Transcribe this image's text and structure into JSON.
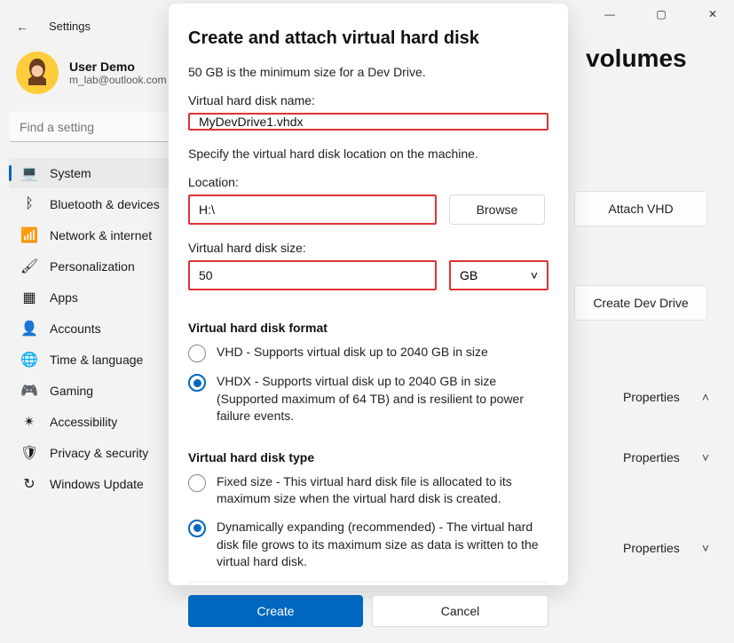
{
  "titlebar": {
    "back": "←",
    "title": "Settings",
    "min": "—",
    "max": "▢",
    "close": "✕"
  },
  "user": {
    "name": "User Demo",
    "email": "m_lab@outlook.com"
  },
  "search": {
    "placeholder": "Find a setting"
  },
  "nav": [
    {
      "icon": "💻",
      "label": "System",
      "active": true
    },
    {
      "icon": "ᛒ",
      "label": "Bluetooth & devices"
    },
    {
      "icon": "📶",
      "label": "Network & internet"
    },
    {
      "icon": "🖌",
      "label": "Personalization"
    },
    {
      "icon": "▦",
      "label": "Apps"
    },
    {
      "icon": "👤",
      "label": "Accounts"
    },
    {
      "icon": "🌐",
      "label": "Time & language"
    },
    {
      "icon": "🎮",
      "label": "Gaming"
    },
    {
      "icon": "✴",
      "label": "Accessibility"
    },
    {
      "icon": "🛡",
      "label": "Privacy & security"
    },
    {
      "icon": "↻",
      "label": "Windows Update"
    }
  ],
  "page": {
    "heading_fragment": "volumes"
  },
  "panelButtons": {
    "attach": "Attach VHD",
    "createDev": "Create Dev Drive"
  },
  "props": {
    "label": "Properties",
    "chev_up": "˄",
    "chev_down": "˅"
  },
  "modal": {
    "title": "Create and attach virtual hard disk",
    "note": "50 GB is the minimum size for a Dev Drive.",
    "name_label": "Virtual hard disk name:",
    "name_value": "MyDevDrive1.vhdx",
    "loc_note": "Specify the virtual hard disk location on the machine.",
    "loc_label": "Location:",
    "loc_value": "H:\\",
    "browse": "Browse",
    "size_label": "Virtual hard disk size:",
    "size_value": "50",
    "size_unit": "GB",
    "format_heading": "Virtual hard disk format",
    "format_vhd": "VHD - Supports virtual disk up to 2040 GB in size",
    "format_vhdx": "VHDX - Supports virtual disk up to 2040 GB in size (Supported maximum of 64 TB) and is resilient to power failure events.",
    "type_heading": "Virtual hard disk type",
    "type_fixed": "Fixed size - This virtual hard disk file is allocated to its maximum size when the virtual hard disk is created.",
    "type_dyn": "Dynamically expanding (recommended) - The virtual hard disk file grows to its maximum size as data is written to the virtual hard disk.",
    "create": "Create",
    "cancel": "Cancel",
    "unit_chev": "˅"
  }
}
